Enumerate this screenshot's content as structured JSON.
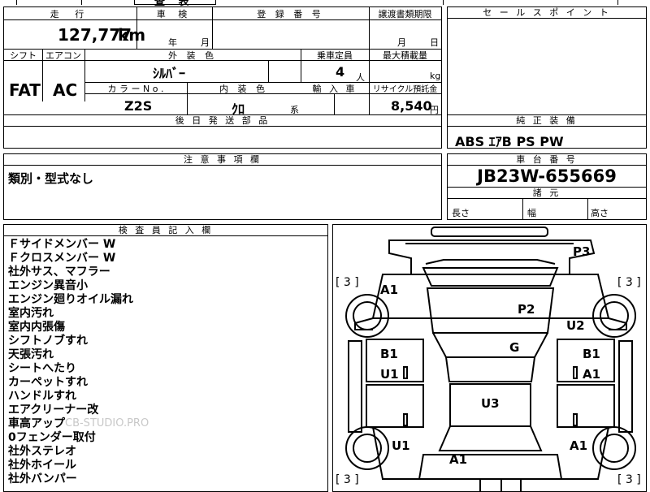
{
  "top_strip": {
    "title_fragment": "査 表"
  },
  "mileage": {
    "header": "走 行",
    "value": "127,777",
    "unit": "km"
  },
  "inspection": {
    "header": "車 検",
    "year_label": "年",
    "month_label": "月"
  },
  "registration": {
    "header": "登 録 番 号"
  },
  "transfer": {
    "header": "譲渡書類期限",
    "month_label": "月",
    "day_label": "日"
  },
  "sales_point": {
    "header": "セ ー ル ス ポ イ ン ト"
  },
  "shift": {
    "header": "シフト",
    "value": "FAT"
  },
  "aircon": {
    "header": "エアコン",
    "value": "AC"
  },
  "exterior_color": {
    "header": "外 装 色",
    "value": "ｼﾙﾊﾞｰ"
  },
  "capacity": {
    "header": "乗車定員",
    "value": "4",
    "unit": "人"
  },
  "max_load": {
    "header": "最大積載量",
    "unit": "kg"
  },
  "color_no": {
    "header": "カ ラ ー N o .",
    "value": "Z2S"
  },
  "interior_color": {
    "header": "内 装 色",
    "value": "ｸﾛ",
    "suffix": "系"
  },
  "import": {
    "header": "輸 入 車"
  },
  "recycle": {
    "header": "リサイクル預託金",
    "value": "8,540",
    "unit": "円"
  },
  "later_parts": {
    "header": "後 日 発 送 部 品"
  },
  "equipment": {
    "header": "純 正 装 備",
    "value": "ABS ｴｱB PS PW"
  },
  "notes": {
    "header": "注 意 事 項 欄",
    "value": "類別・型式なし"
  },
  "chassis": {
    "header": "車 台 番 号",
    "value": "JB23W-655669"
  },
  "dimensions": {
    "header": "諸 元",
    "length_label": "長さ",
    "width_label": "幅",
    "height_label": "高さ"
  },
  "inspector": {
    "header": "検 査 員 記 入 欄",
    "items": [
      "Ｆサイドメンバー W",
      "Ｆクロスメンバー W",
      "社外サス、マフラー",
      "エンジン異音小",
      "エンジン廻りオイル漏れ",
      "室内汚れ",
      "室内内張傷",
      "シフトノブすれ",
      "天張汚れ",
      "シートへたり",
      "カーペットすれ",
      "ハンドルすれ",
      "エアクリーナー改",
      "車高アップ",
      "0フェンダー取付",
      "社外ステレオ",
      "社外ホイール",
      "社外バンパー"
    ]
  },
  "watermark": "CB-STUDIO.PRO",
  "diagram": {
    "codes": {
      "p3": "P3",
      "a1_front_left": "A1",
      "p2": "P2",
      "u2": "U2",
      "g": "G",
      "b1_left": "B1",
      "u1_left": "U1",
      "b1_right": "B1",
      "a1_right": "A1",
      "u3": "U3",
      "u1_rear_left": "U1",
      "a1_rear_right": "A1",
      "a1_rear": "A1"
    },
    "tire_tl": "[ 3 ]",
    "tire_tr": "[ 3 ]",
    "tire_bl": "[ 3 ]",
    "tire_br": "[ 3 ]"
  }
}
